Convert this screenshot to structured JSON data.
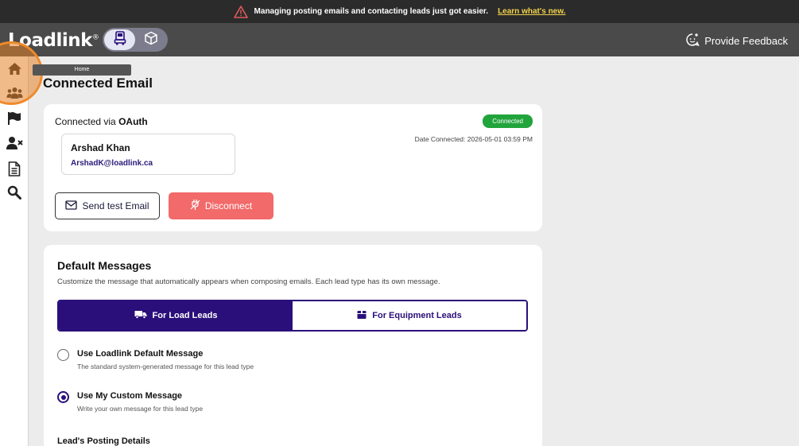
{
  "banner": {
    "message": "Managing posting emails and contacting leads just got easier.",
    "link": "Learn what's new."
  },
  "header": {
    "logo": "Loadlink",
    "logo_mark": "®",
    "feedback_label": "Provide Feedback"
  },
  "sidebar": {
    "tooltip": "Home",
    "items": [
      "home-icon",
      "users-icon",
      "flag-icon",
      "user-block-icon",
      "document-icon",
      "search-icon"
    ]
  },
  "page": {
    "title": "Connected Email"
  },
  "connection": {
    "via_prefix": "Connected via",
    "via_method": "OAuth",
    "status": "Connected",
    "date_connected": "Date Connected: 2026-05-01 03:59 PM",
    "user_name": "Arshad Khan",
    "user_email": "ArshadK@loadlink.ca",
    "send_test_label": "Send test Email",
    "disconnect_label": "Disconnect"
  },
  "default_messages": {
    "title": "Default Messages",
    "description": "Customize the message that automatically appears when composing emails. Each lead type has its own message.",
    "tabs": [
      {
        "label": "For Load Leads",
        "active": true
      },
      {
        "label": "For Equipment Leads",
        "active": false
      }
    ],
    "options": [
      {
        "label": "Use Loadlink Default Message",
        "sub": "The standard system-generated message for this lead type",
        "checked": false
      },
      {
        "label": "Use My Custom Message",
        "sub": "Write your own message for this lead type",
        "checked": true
      }
    ],
    "posting_details_label": "Lead's Posting Details"
  },
  "colors": {
    "primary": "#2a0f7a",
    "connected": "#21a43b",
    "disconnect": "#f26a6a",
    "highlight": "#ef8a2a"
  }
}
